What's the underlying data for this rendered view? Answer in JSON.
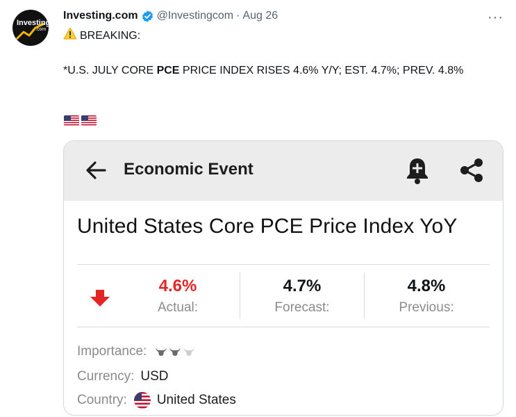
{
  "tweet": {
    "author_name": "Investing.com",
    "handle": "@Investingcom",
    "separator": "·",
    "date": "Aug 26",
    "more": "···",
    "breaking": "BREAKING:",
    "body_prefix": "*U.S. JULY CORE ",
    "body_bold": "PCE",
    "body_suffix": " PRICE INDEX RISES 4.6% Y/Y; EST. 4.7%; PREV. 4.8%",
    "avatar_brand": "Investing",
    "avatar_sub": ".com",
    "icons": [
      "verified-badge-icon",
      "warning-icon",
      "us-flag-icon",
      "more-icon"
    ]
  },
  "card": {
    "header_title": "Economic Event",
    "event_title": "United States Core PCE Price Index YoY",
    "actual": {
      "value": "4.6%",
      "label": "Actual:",
      "color": "#e52424"
    },
    "forecast": {
      "value": "4.7%",
      "label": "Forecast:"
    },
    "previous": {
      "value": "4.8%",
      "label": "Previous:"
    },
    "importance_label": "Importance:",
    "importance_level": 2,
    "importance_max": 3,
    "currency_label": "Currency:",
    "currency_value": "USD",
    "country_label": "Country:",
    "country_value": "United States",
    "icons": [
      "back-arrow-icon",
      "bell-plus-icon",
      "share-icon",
      "down-arrow-icon",
      "bull-icon"
    ]
  },
  "colors": {
    "accent_red": "#e52424",
    "verified_blue": "#1d9bf0",
    "card_header_bg": "#ececec"
  }
}
